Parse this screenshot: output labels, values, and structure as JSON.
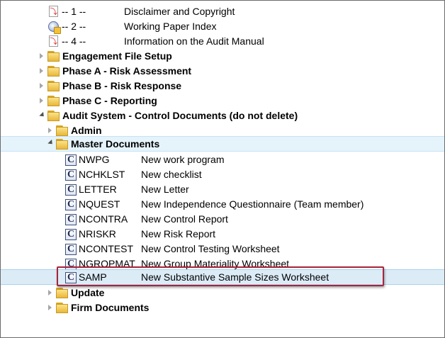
{
  "tree": {
    "pdf_items": [
      {
        "num": "-- 1 --",
        "desc": "Disclaimer and Copyright",
        "icon": "pdf-icon"
      },
      {
        "num": "-- 2 --",
        "desc": "Working Paper Index",
        "icon": "working-paper-icon"
      },
      {
        "num": "-- 4 --",
        "desc": "Information on the Audit Manual",
        "icon": "pdf-icon"
      }
    ],
    "folders": [
      {
        "label": "Engagement File Setup",
        "expanded": false
      },
      {
        "label": "Phase A - Risk Assessment",
        "expanded": false
      },
      {
        "label": "Phase B - Risk Response",
        "expanded": false
      },
      {
        "label": "Phase C - Reporting",
        "expanded": false
      },
      {
        "label": "Audit System - Control Documents (do not delete)",
        "expanded": true
      }
    ],
    "subfolders": [
      {
        "label": "Admin",
        "expanded": false
      },
      {
        "label": "Master Documents",
        "expanded": true
      },
      {
        "label": "Update",
        "expanded": false
      },
      {
        "label": "Firm Documents",
        "expanded": false
      }
    ],
    "master_documents": [
      {
        "code": "NWPG",
        "desc": "New work program"
      },
      {
        "code": "NCHKLST",
        "desc": "New checklist"
      },
      {
        "code": "LETTER",
        "desc": "New Letter"
      },
      {
        "code": "NQUEST",
        "desc": "New Independence Questionnaire (Team member)"
      },
      {
        "code": "NCONTRA",
        "desc": "New Control Report"
      },
      {
        "code": "NRISKR",
        "desc": "New Risk Report"
      },
      {
        "code": "NCONTEST",
        "desc": "New Control Testing Worksheet"
      },
      {
        "code": "NGROPMAT",
        "desc": "New Group Materiality Worksheet"
      },
      {
        "code": "SAMP",
        "desc": "New Substantive Sample Sizes Worksheet"
      }
    ],
    "selected_code": "SAMP",
    "highlight_color": "#a8243a"
  }
}
